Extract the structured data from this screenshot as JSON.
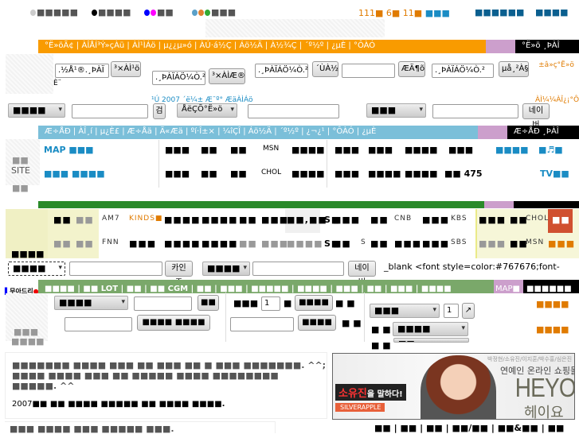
{
  "top": {
    "links": [
      "■■■■■",
      "■■■■",
      "■■",
      "■■■"
    ],
    "counts": [
      "111■",
      "6■",
      "11■",
      "■■■"
    ],
    "right_links": [
      "■■■■■■",
      "■■■■"
    ]
  },
  "nav1": {
    "text": "°Ë»öÃ¢ | ÀÎÅÍ³Ý»çÀü | ÀÌ¹ÌÁö | µ¿¿µ»ó | ÀÚ·á½Ç | Áö½Ä | À½¾Ç | ´º½º | ¿µÈ­ | °ÔÀÓ",
    "right": "°Ë»ö ¸ÞÀÎ"
  },
  "search1": {
    "fields": [
      ".½Å¹®.¸ÞÀÏ",
      ".¸ÞÀÏÁÖ¼Ò.²",
      ".¸ÞÀÏÁÖ¼Ò.²",
      "",
      ".¸ÞÀÏÁÖ¼Ò.²"
    ],
    "buttons": [
      "³×ÀÌ¹ö",
      "³×ÀÌÆ®",
      "´ÙÀ½",
      "ÆÄ¶õ",
      "µå¸²À§"
    ],
    "orange": "±â»ç°Ë»ö",
    "small": "È¨"
  },
  "row2": {
    "select1": "■■■■",
    "btn1": "검",
    "select2": "ÅëÇÕ°Ë»ö",
    "link": "¹Ú 2007 ´ë¼± Æ¯º° ÆäÀÌÁö",
    "select3": "■■■",
    "btn3": "네이버",
    "orange": "ÀÌ¼¼ÀÎ¿¡°Ô"
  },
  "nav2": {
    "text": "Æ÷ÅÐ | ÀÎ¸í | µ¿È£ | Æ÷Åä | Ä«Æä | ºí·Î±× | ¼îÇÎ | Áö½Ä | ´º½º | ¿¬¿¹ | °ÔÀÓ | ¿µÈ­",
    "right": "Æ÷ÅÐ ¸ÞÀÎ"
  },
  "sites": {
    "side": [
      "■■",
      "SITE",
      "■■"
    ],
    "r1": [
      "MAP ■■■",
      "■■■",
      "■■",
      "■■",
      "MSN",
      "■■■■",
      "■■■",
      "■■■",
      "■■■■",
      "■■■",
      "■■■■",
      "■♬■"
    ],
    "r2": [
      "■■■ ■■■■",
      "■■■",
      "■■",
      "■■",
      "CHOL",
      "■■■■",
      "■■■",
      "■■■■",
      "■■■■",
      "■■ 475",
      "TV■■"
    ]
  },
  "news": {
    "side": "■■■■",
    "r1": [
      "■■",
      "■■",
      "AM7",
      "KINDS■",
      "■■■■",
      "■■■■",
      "■■",
      "■■■",
      "■■,■■",
      "S■",
      "■■■",
      "■■",
      "CNB",
      "■■■",
      "KBS",
      "■■■",
      "■■",
      "CHOL",
      "■■"
    ],
    "r2": [
      "■■",
      "■■",
      "FNN",
      "■■■",
      "■■■■",
      "■■■■",
      "■■",
      "■■■",
      "■■■■",
      "S■",
      "■■",
      "S",
      "■■",
      "■■■",
      "■■■",
      "SBS",
      "■■■",
      "■■",
      "MSN",
      "■■■"
    ]
  },
  "search2": {
    "select1": "■■■■",
    "btn1": "카인즈",
    "select2": "■■■■",
    "btn2": "네이버",
    "code": "_blank <font style=color:#767676;font-"
  },
  "nav3": {
    "left": "무아드리",
    "text": "■■■■ | ■■ LOT | ■■ | ■■ CGM | ■■ | ■■■ | ■■■■■ | ■■■■ | ■■■ | ■■ | ■■■ | ■■■■",
    "purple": "MAP■",
    "right": "■■■■■■"
  },
  "forms": {
    "side": [
      "■■■",
      "■■■■"
    ],
    "sel1": "■■■■",
    "btn1": "■■",
    "btn2": "■■■■ ■■■■",
    "label1": "■■■",
    "num1": "1",
    "unit1": "■",
    "btn3": "■■■■",
    "t1": "■ ■",
    "btn4": "■■■■",
    "t2": "■ ■",
    "sel2": "■■■",
    "num2": "1",
    "arrow": "↗",
    "t3": "■ ■",
    "sel3": "■■■■",
    "t4": "■ ■",
    "sel4": "■■",
    "or1": "■■■■",
    "or2": "■■■■"
  },
  "notice": {
    "lines": [
      "■■■■■■■ ■■■■ ■■■ ■■ ■■■ ■■ ■ ■■■ ■■■■■■■. ^^;",
      "■■■■ ■■■■ ■■■ ■■ ■■■■■ ■■■■ ■■■■■■■■",
      "■■■■■. ^^"
    ],
    "year": "2007",
    "headline": "■■ ■■ ■■■■ ■■■■■ ■■ ■■■■ ■■■■."
  },
  "banner": {
    "names": "박정현/소유진/이지훈/박수홍/심은진",
    "tagline": "연예인 온라인 쇼핑몰",
    "brand": "HEYO",
    "brand_kr": "헤이요",
    "slogan_a": "소유진",
    "slogan_b": "을 말하다!",
    "maker": "SILVERAPPLE"
  },
  "footer": {
    "left": "■■■ ■■■■ ■■■ ■■■■■ ■■■.",
    "links": [
      "■■",
      "■■",
      "■■",
      "■■/■■",
      "■■&■■",
      "■■"
    ]
  }
}
